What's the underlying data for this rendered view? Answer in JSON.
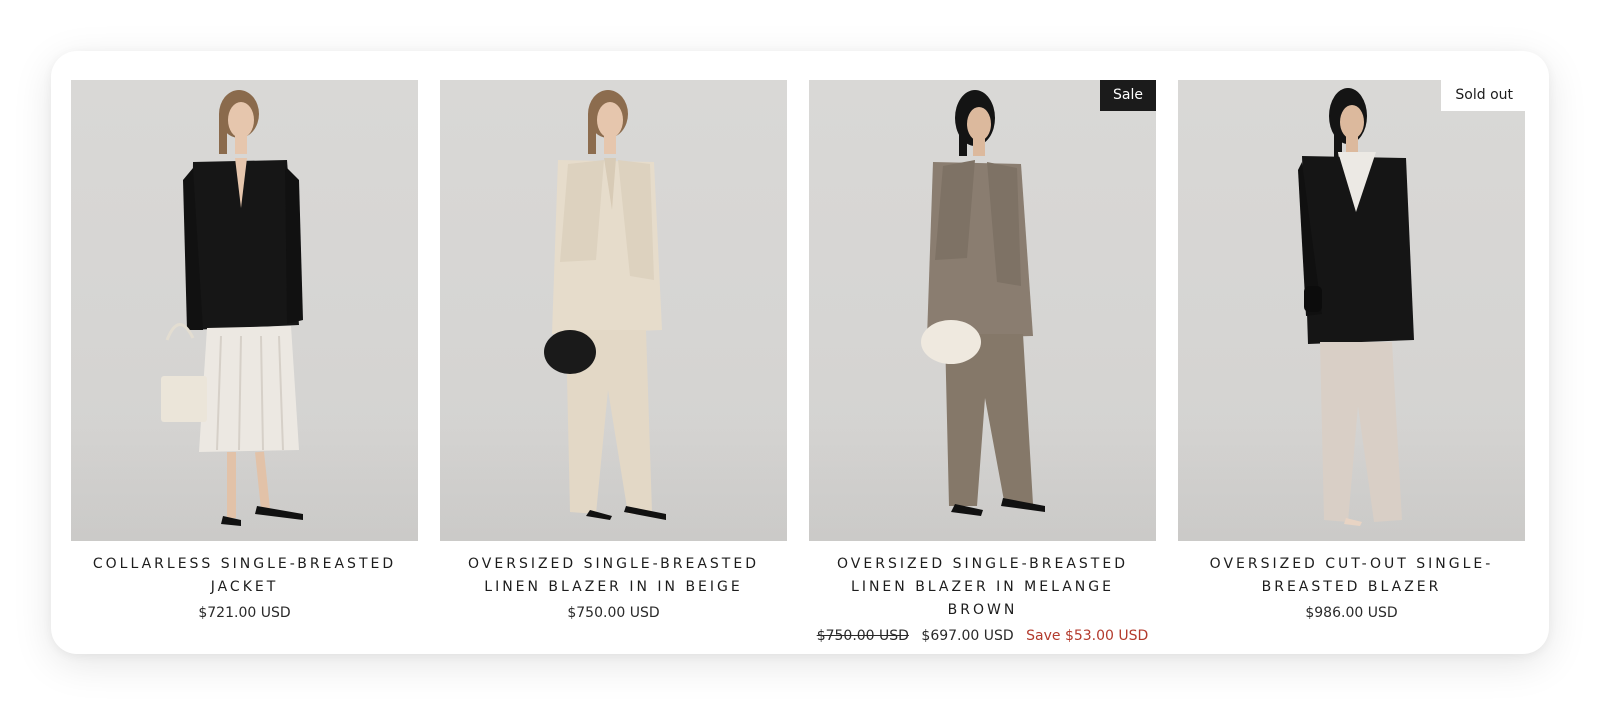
{
  "products": [
    {
      "title": "COLLARLESS SINGLE-BREASTED JACKET",
      "price": "$721.00 USD",
      "badge": "",
      "image_alt": "Model wearing black collarless jacket with pleated skirt"
    },
    {
      "title": "OVERSIZED SINGLE-BREASTED LINEN BLAZER IN IN BEIGE",
      "price": "$750.00 USD",
      "badge": "",
      "image_alt": "Model wearing beige linen blazer and trousers"
    },
    {
      "title": "OVERSIZED SINGLE-BREASTED LINEN BLAZER IN MELANGE BROWN",
      "compare_price": "$750.00 USD",
      "price": "$697.00 USD",
      "save": "Save $53.00 USD",
      "badge": "Sale",
      "image_alt": "Model wearing melange brown linen blazer and trousers"
    },
    {
      "title": "OVERSIZED CUT-OUT SINGLE-BREASTED BLAZER",
      "price": "$986.00 USD",
      "badge": "Sold out",
      "image_alt": "Model wearing black cut-out blazer with sheer trousers"
    }
  ],
  "colors": {
    "sale_badge_bg": "#1b1b1b",
    "save_text": "#b33a2c",
    "photo_bg": "#d7d6d4"
  }
}
